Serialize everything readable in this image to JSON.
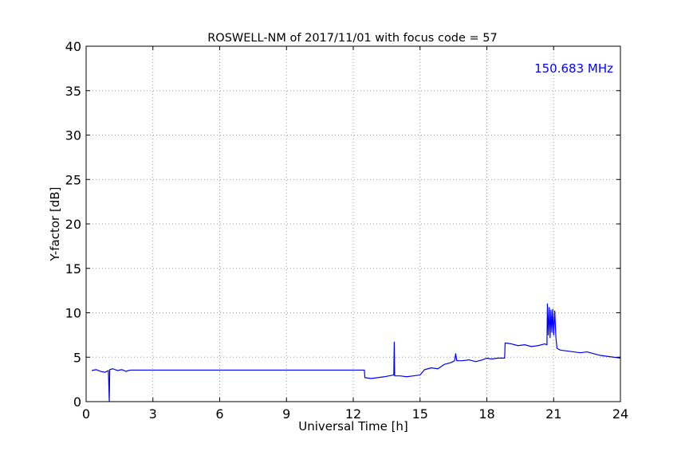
{
  "chart_data": {
    "type": "line",
    "title": "ROSWELL-NM of 2017/11/01 with focus code = 57",
    "xlabel": "Universal Time [h]",
    "ylabel": "Y-factor [dB]",
    "xlim": [
      0,
      24
    ],
    "ylim": [
      0,
      40
    ],
    "x_ticks": [
      0,
      3,
      6,
      9,
      12,
      15,
      18,
      21,
      24
    ],
    "y_ticks": [
      0,
      5,
      10,
      15,
      20,
      25,
      30,
      35,
      40
    ],
    "x_tick_labels": [
      "0",
      "3",
      "6",
      "9",
      "12",
      "15",
      "18",
      "21",
      "24"
    ],
    "y_tick_labels": [
      "0",
      "5",
      "10",
      "15",
      "20",
      "25",
      "30",
      "35",
      "40"
    ],
    "grid": true,
    "line_color": "#0000ff",
    "annotation": {
      "text": "150.683 MHz",
      "color": "#0000ff",
      "placement": "top-right"
    },
    "series": [
      {
        "values": [
          [
            0.25,
            3.5
          ],
          [
            0.45,
            3.6
          ],
          [
            0.65,
            3.4
          ],
          [
            0.85,
            3.3
          ],
          [
            1.0,
            3.5
          ],
          [
            1.04,
            0.0
          ],
          [
            1.06,
            3.6
          ],
          [
            1.2,
            3.7
          ],
          [
            1.4,
            3.5
          ],
          [
            1.6,
            3.6
          ],
          [
            1.8,
            3.4
          ],
          [
            1.9,
            3.5
          ],
          [
            2.0,
            3.55
          ],
          [
            5.0,
            3.55
          ],
          [
            8.0,
            3.55
          ],
          [
            11.0,
            3.55
          ],
          [
            12.5,
            3.55
          ],
          [
            12.52,
            2.7
          ],
          [
            12.8,
            2.6
          ],
          [
            13.1,
            2.7
          ],
          [
            13.4,
            2.8
          ],
          [
            13.6,
            2.9
          ],
          [
            13.82,
            3.0
          ],
          [
            13.84,
            6.7
          ],
          [
            13.86,
            2.9
          ],
          [
            14.1,
            2.9
          ],
          [
            14.4,
            2.8
          ],
          [
            14.7,
            2.9
          ],
          [
            15.0,
            3.0
          ],
          [
            15.2,
            3.6
          ],
          [
            15.5,
            3.8
          ],
          [
            15.8,
            3.7
          ],
          [
            16.1,
            4.2
          ],
          [
            16.4,
            4.4
          ],
          [
            16.55,
            4.6
          ],
          [
            16.6,
            5.4
          ],
          [
            16.65,
            4.6
          ],
          [
            16.9,
            4.6
          ],
          [
            17.2,
            4.7
          ],
          [
            17.5,
            4.5
          ],
          [
            17.8,
            4.7
          ],
          [
            18.0,
            4.9
          ],
          [
            18.2,
            4.8
          ],
          [
            18.5,
            4.9
          ],
          [
            18.8,
            4.9
          ],
          [
            18.82,
            6.6
          ],
          [
            19.1,
            6.5
          ],
          [
            19.4,
            6.3
          ],
          [
            19.7,
            6.4
          ],
          [
            20.0,
            6.2
          ],
          [
            20.3,
            6.3
          ],
          [
            20.6,
            6.5
          ],
          [
            20.7,
            6.4
          ],
          [
            20.72,
            11.0
          ],
          [
            20.76,
            7.5
          ],
          [
            20.8,
            10.6
          ],
          [
            20.84,
            7.2
          ],
          [
            20.88,
            10.3
          ],
          [
            20.92,
            7.8
          ],
          [
            20.96,
            10.4
          ],
          [
            21.0,
            7.5
          ],
          [
            21.05,
            10.2
          ],
          [
            21.1,
            7.3
          ],
          [
            21.15,
            6.0
          ],
          [
            21.3,
            5.8
          ],
          [
            21.6,
            5.7
          ],
          [
            21.9,
            5.6
          ],
          [
            22.2,
            5.5
          ],
          [
            22.5,
            5.6
          ],
          [
            22.8,
            5.4
          ],
          [
            23.1,
            5.2
          ],
          [
            23.4,
            5.1
          ],
          [
            23.7,
            5.0
          ],
          [
            24.0,
            4.9
          ]
        ]
      }
    ]
  }
}
